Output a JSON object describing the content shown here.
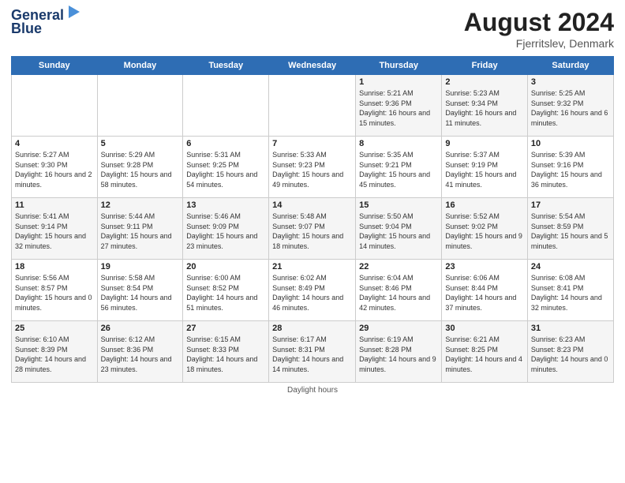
{
  "header": {
    "logo_line1": "General",
    "logo_line2": "Blue",
    "month_year": "August 2024",
    "location": "Fjerritslev, Denmark"
  },
  "days_of_week": [
    "Sunday",
    "Monday",
    "Tuesday",
    "Wednesday",
    "Thursday",
    "Friday",
    "Saturday"
  ],
  "footer": {
    "daylight_label": "Daylight hours"
  },
  "weeks": [
    [
      {
        "day": "",
        "sunrise": "",
        "sunset": "",
        "daylight": ""
      },
      {
        "day": "",
        "sunrise": "",
        "sunset": "",
        "daylight": ""
      },
      {
        "day": "",
        "sunrise": "",
        "sunset": "",
        "daylight": ""
      },
      {
        "day": "",
        "sunrise": "",
        "sunset": "",
        "daylight": ""
      },
      {
        "day": "1",
        "sunrise": "Sunrise: 5:21 AM",
        "sunset": "Sunset: 9:36 PM",
        "daylight": "Daylight: 16 hours and 15 minutes."
      },
      {
        "day": "2",
        "sunrise": "Sunrise: 5:23 AM",
        "sunset": "Sunset: 9:34 PM",
        "daylight": "Daylight: 16 hours and 11 minutes."
      },
      {
        "day": "3",
        "sunrise": "Sunrise: 5:25 AM",
        "sunset": "Sunset: 9:32 PM",
        "daylight": "Daylight: 16 hours and 6 minutes."
      }
    ],
    [
      {
        "day": "4",
        "sunrise": "Sunrise: 5:27 AM",
        "sunset": "Sunset: 9:30 PM",
        "daylight": "Daylight: 16 hours and 2 minutes."
      },
      {
        "day": "5",
        "sunrise": "Sunrise: 5:29 AM",
        "sunset": "Sunset: 9:28 PM",
        "daylight": "Daylight: 15 hours and 58 minutes."
      },
      {
        "day": "6",
        "sunrise": "Sunrise: 5:31 AM",
        "sunset": "Sunset: 9:25 PM",
        "daylight": "Daylight: 15 hours and 54 minutes."
      },
      {
        "day": "7",
        "sunrise": "Sunrise: 5:33 AM",
        "sunset": "Sunset: 9:23 PM",
        "daylight": "Daylight: 15 hours and 49 minutes."
      },
      {
        "day": "8",
        "sunrise": "Sunrise: 5:35 AM",
        "sunset": "Sunset: 9:21 PM",
        "daylight": "Daylight: 15 hours and 45 minutes."
      },
      {
        "day": "9",
        "sunrise": "Sunrise: 5:37 AM",
        "sunset": "Sunset: 9:19 PM",
        "daylight": "Daylight: 15 hours and 41 minutes."
      },
      {
        "day": "10",
        "sunrise": "Sunrise: 5:39 AM",
        "sunset": "Sunset: 9:16 PM",
        "daylight": "Daylight: 15 hours and 36 minutes."
      }
    ],
    [
      {
        "day": "11",
        "sunrise": "Sunrise: 5:41 AM",
        "sunset": "Sunset: 9:14 PM",
        "daylight": "Daylight: 15 hours and 32 minutes."
      },
      {
        "day": "12",
        "sunrise": "Sunrise: 5:44 AM",
        "sunset": "Sunset: 9:11 PM",
        "daylight": "Daylight: 15 hours and 27 minutes."
      },
      {
        "day": "13",
        "sunrise": "Sunrise: 5:46 AM",
        "sunset": "Sunset: 9:09 PM",
        "daylight": "Daylight: 15 hours and 23 minutes."
      },
      {
        "day": "14",
        "sunrise": "Sunrise: 5:48 AM",
        "sunset": "Sunset: 9:07 PM",
        "daylight": "Daylight: 15 hours and 18 minutes."
      },
      {
        "day": "15",
        "sunrise": "Sunrise: 5:50 AM",
        "sunset": "Sunset: 9:04 PM",
        "daylight": "Daylight: 15 hours and 14 minutes."
      },
      {
        "day": "16",
        "sunrise": "Sunrise: 5:52 AM",
        "sunset": "Sunset: 9:02 PM",
        "daylight": "Daylight: 15 hours and 9 minutes."
      },
      {
        "day": "17",
        "sunrise": "Sunrise: 5:54 AM",
        "sunset": "Sunset: 8:59 PM",
        "daylight": "Daylight: 15 hours and 5 minutes."
      }
    ],
    [
      {
        "day": "18",
        "sunrise": "Sunrise: 5:56 AM",
        "sunset": "Sunset: 8:57 PM",
        "daylight": "Daylight: 15 hours and 0 minutes."
      },
      {
        "day": "19",
        "sunrise": "Sunrise: 5:58 AM",
        "sunset": "Sunset: 8:54 PM",
        "daylight": "Daylight: 14 hours and 56 minutes."
      },
      {
        "day": "20",
        "sunrise": "Sunrise: 6:00 AM",
        "sunset": "Sunset: 8:52 PM",
        "daylight": "Daylight: 14 hours and 51 minutes."
      },
      {
        "day": "21",
        "sunrise": "Sunrise: 6:02 AM",
        "sunset": "Sunset: 8:49 PM",
        "daylight": "Daylight: 14 hours and 46 minutes."
      },
      {
        "day": "22",
        "sunrise": "Sunrise: 6:04 AM",
        "sunset": "Sunset: 8:46 PM",
        "daylight": "Daylight: 14 hours and 42 minutes."
      },
      {
        "day": "23",
        "sunrise": "Sunrise: 6:06 AM",
        "sunset": "Sunset: 8:44 PM",
        "daylight": "Daylight: 14 hours and 37 minutes."
      },
      {
        "day": "24",
        "sunrise": "Sunrise: 6:08 AM",
        "sunset": "Sunset: 8:41 PM",
        "daylight": "Daylight: 14 hours and 32 minutes."
      }
    ],
    [
      {
        "day": "25",
        "sunrise": "Sunrise: 6:10 AM",
        "sunset": "Sunset: 8:39 PM",
        "daylight": "Daylight: 14 hours and 28 minutes."
      },
      {
        "day": "26",
        "sunrise": "Sunrise: 6:12 AM",
        "sunset": "Sunset: 8:36 PM",
        "daylight": "Daylight: 14 hours and 23 minutes."
      },
      {
        "day": "27",
        "sunrise": "Sunrise: 6:15 AM",
        "sunset": "Sunset: 8:33 PM",
        "daylight": "Daylight: 14 hours and 18 minutes."
      },
      {
        "day": "28",
        "sunrise": "Sunrise: 6:17 AM",
        "sunset": "Sunset: 8:31 PM",
        "daylight": "Daylight: 14 hours and 14 minutes."
      },
      {
        "day": "29",
        "sunrise": "Sunrise: 6:19 AM",
        "sunset": "Sunset: 8:28 PM",
        "daylight": "Daylight: 14 hours and 9 minutes."
      },
      {
        "day": "30",
        "sunrise": "Sunrise: 6:21 AM",
        "sunset": "Sunset: 8:25 PM",
        "daylight": "Daylight: 14 hours and 4 minutes."
      },
      {
        "day": "31",
        "sunrise": "Sunrise: 6:23 AM",
        "sunset": "Sunset: 8:23 PM",
        "daylight": "Daylight: 14 hours and 0 minutes."
      }
    ]
  ]
}
